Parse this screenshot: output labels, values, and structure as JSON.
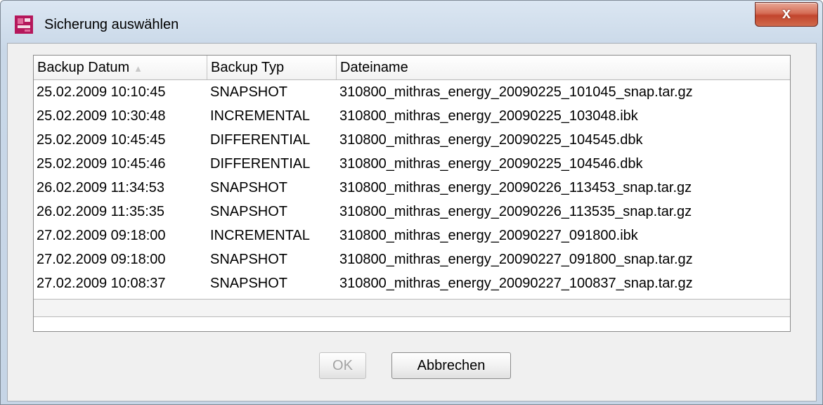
{
  "window": {
    "title": "Sicherung auswählen",
    "close_label": "x"
  },
  "table": {
    "columns": [
      {
        "label": "Backup Datum",
        "sort_indicator": "▲"
      },
      {
        "label": "Backup Typ"
      },
      {
        "label": "Dateiname"
      }
    ],
    "rows": [
      {
        "date": "25.02.2009 10:10:45",
        "type": "SNAPSHOT",
        "file": "310800_mithras_energy_20090225_101045_snap.tar.gz"
      },
      {
        "date": "25.02.2009 10:30:48",
        "type": "INCREMENTAL",
        "file": "310800_mithras_energy_20090225_103048.ibk"
      },
      {
        "date": "25.02.2009 10:45:45",
        "type": "DIFFERENTIAL",
        "file": "310800_mithras_energy_20090225_104545.dbk"
      },
      {
        "date": "25.02.2009 10:45:46",
        "type": "DIFFERENTIAL",
        "file": "310800_mithras_energy_20090225_104546.dbk"
      },
      {
        "date": "26.02.2009 11:34:53",
        "type": "SNAPSHOT",
        "file": "310800_mithras_energy_20090226_113453_snap.tar.gz"
      },
      {
        "date": "26.02.2009 11:35:35",
        "type": "SNAPSHOT",
        "file": "310800_mithras_energy_20090226_113535_snap.tar.gz"
      },
      {
        "date": "27.02.2009 09:18:00",
        "type": "INCREMENTAL",
        "file": "310800_mithras_energy_20090227_091800.ibk"
      },
      {
        "date": "27.02.2009 09:18:00",
        "type": "SNAPSHOT",
        "file": "310800_mithras_energy_20090227_091800_snap.tar.gz"
      },
      {
        "date": "27.02.2009 10:08:37",
        "type": "SNAPSHOT",
        "file": "310800_mithras_energy_20090227_100837_snap.tar.gz"
      }
    ]
  },
  "buttons": {
    "ok_label": "OK",
    "cancel_label": "Abbrechen"
  },
  "colors": {
    "app_icon_primary": "#b5175b",
    "close_button": "#c2452d"
  }
}
